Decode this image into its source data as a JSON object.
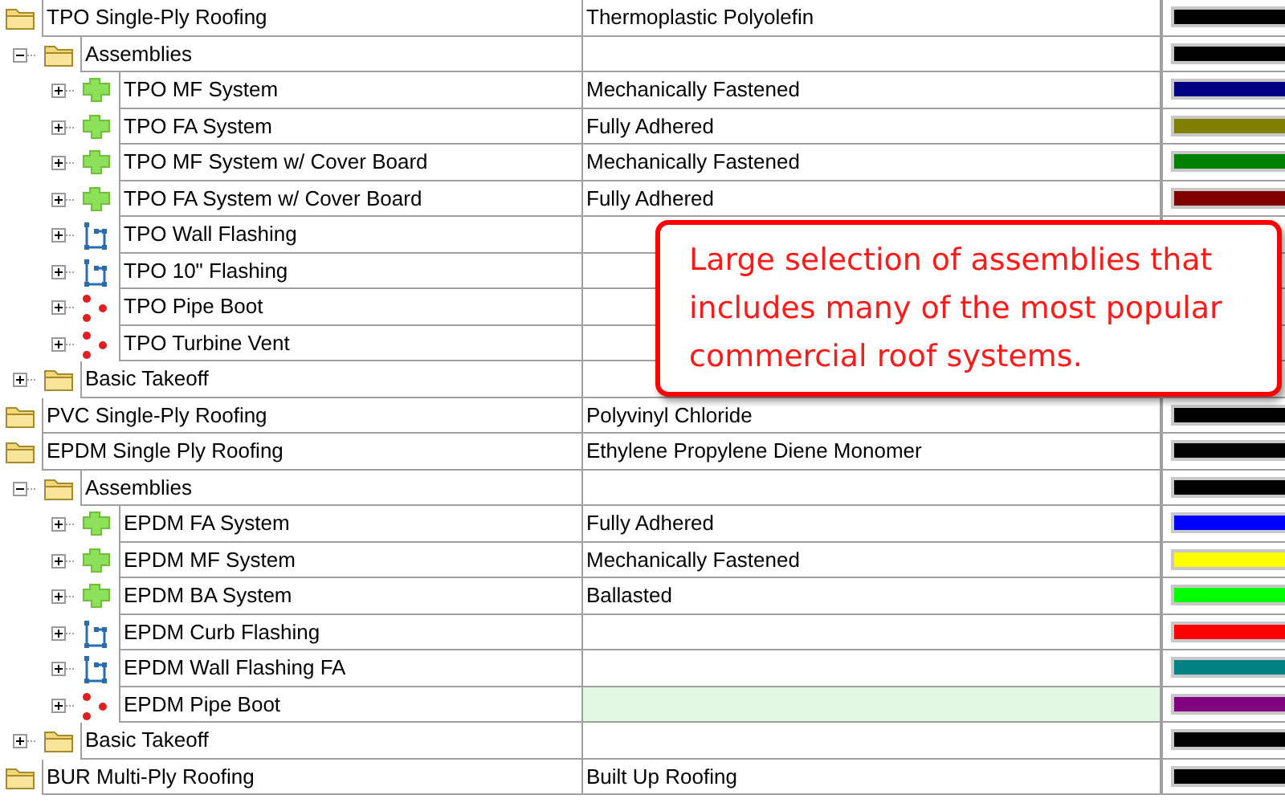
{
  "tree": [
    {
      "name": "TPO Single-Ply Roofing",
      "kind": "folder",
      "description": "Thermoplastic Polyolefin",
      "color": "#000000",
      "selected": false,
      "children": [
        {
          "name": "Assemblies",
          "kind": "folder",
          "expanded": true,
          "color": "#000000",
          "selected": false,
          "children": [
            {
              "name": "TPO MF System",
              "kind": "assembly",
              "expanded": false,
              "description": "Mechanically Fastened",
              "color": "#000080",
              "selected": false
            },
            {
              "name": "TPO FA System",
              "kind": "assembly",
              "expanded": false,
              "description": "Fully Adhered",
              "color": "#808000",
              "selected": false
            },
            {
              "name": "TPO MF System w/ Cover Board",
              "kind": "assembly",
              "expanded": false,
              "description": "Mechanically Fastened",
              "color": "#008000",
              "selected": false
            },
            {
              "name": "TPO FA System w/ Cover Board",
              "kind": "assembly",
              "expanded": false,
              "description": "Fully Adhered",
              "color": "#800000",
              "selected": false
            },
            {
              "name": "TPO Wall Flashing",
              "kind": "linear",
              "expanded": false,
              "selected": false
            },
            {
              "name": "TPO 10\" Flashing",
              "kind": "linear",
              "expanded": false,
              "selected": false
            },
            {
              "name": "TPO Pipe Boot",
              "kind": "count",
              "expanded": false,
              "selected": false
            },
            {
              "name": "TPO Turbine Vent",
              "kind": "count",
              "expanded": false,
              "selected": false
            }
          ]
        },
        {
          "name": "Basic Takeoff",
          "kind": "folder",
          "expanded": false,
          "selected": false
        }
      ]
    },
    {
      "name": "PVC Single-Ply Roofing",
      "kind": "folder",
      "description": "Polyvinyl Chloride",
      "color": "#000000",
      "selected": false
    },
    {
      "name": "EPDM Single Ply Roofing",
      "kind": "folder",
      "description": "Ethylene Propylene Diene Monomer",
      "color": "#000000",
      "selected": false,
      "children": [
        {
          "name": "Assemblies",
          "kind": "folder",
          "expanded": true,
          "color": "#000000",
          "selected": false,
          "children": [
            {
              "name": "EPDM FA System",
              "kind": "assembly",
              "expanded": false,
              "description": "Fully Adhered",
              "color": "#0000ff",
              "selected": false
            },
            {
              "name": "EPDM MF System",
              "kind": "assembly",
              "expanded": false,
              "description": "Mechanically Fastened",
              "color": "#ffff00",
              "selected": false
            },
            {
              "name": "EPDM BA System",
              "kind": "assembly",
              "expanded": false,
              "description": "Ballasted",
              "color": "#00ff00",
              "selected": false
            },
            {
              "name": "EPDM Curb Flashing",
              "kind": "linear",
              "expanded": false,
              "color": "#ff0000",
              "selected": false
            },
            {
              "name": "EPDM Wall Flashing FA",
              "kind": "linear",
              "expanded": false,
              "color": "#008080",
              "selected": false
            },
            {
              "name": "EPDM Pipe Boot",
              "kind": "count",
              "expanded": false,
              "color": "#800080",
              "selected": true
            }
          ]
        },
        {
          "name": "Basic Takeoff",
          "kind": "folder",
          "expanded": false,
          "color": "#000000",
          "selected": false
        }
      ]
    },
    {
      "name": "BUR Multi-Ply Roofing",
      "kind": "folder",
      "description": "Built Up Roofing",
      "color": "#000000",
      "selected": false
    }
  ],
  "callout": {
    "text": "Large selection of assemblies that includes many of the most popular commercial roof systems."
  }
}
